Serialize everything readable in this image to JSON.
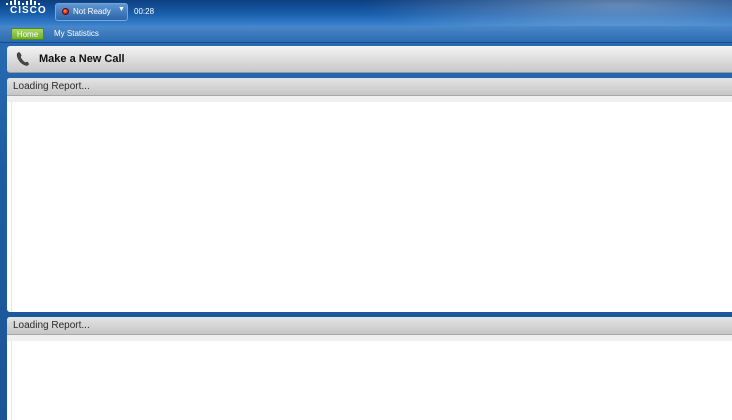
{
  "brand": {
    "logo_text": "CISCO"
  },
  "agent_status": {
    "label": "Not Ready",
    "timer": "00:28",
    "status_color": "#d32a1a"
  },
  "nav": {
    "tabs": [
      {
        "label": "Home",
        "active": true
      },
      {
        "label": "My Statistics",
        "active": false
      }
    ]
  },
  "call_bar": {
    "label": "Make a New Call",
    "icon": "phone-icon"
  },
  "reports": [
    {
      "title": "Loading Report..."
    },
    {
      "title": "Loading Report..."
    }
  ],
  "colors": {
    "header_blue": "#1a5fae",
    "active_tab_green": "#6fae2a"
  }
}
